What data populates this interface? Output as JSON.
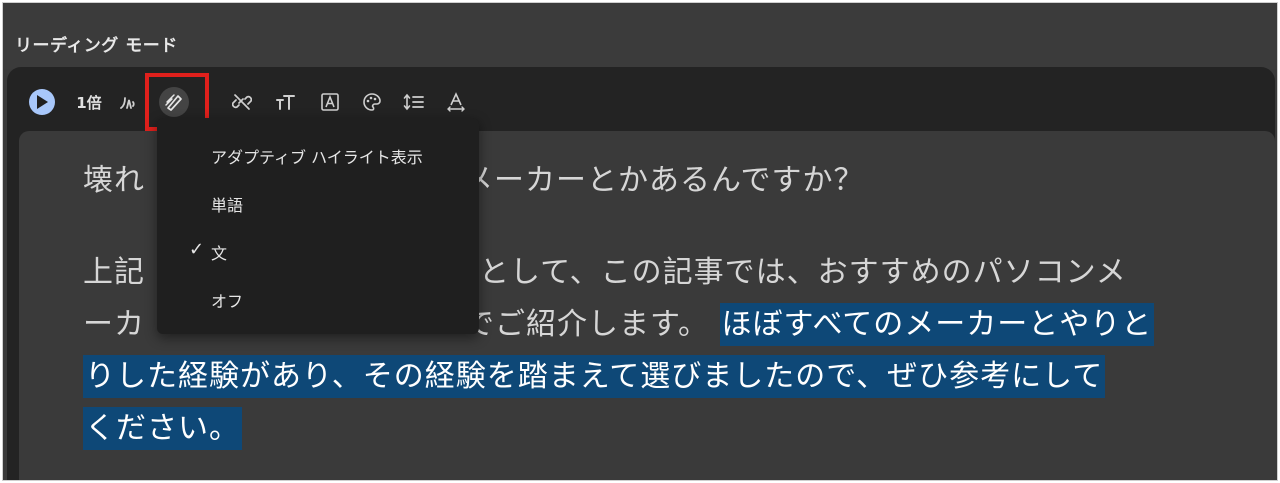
{
  "window": {
    "title": "リーディング モード"
  },
  "toolbar": {
    "play_icon": "play-icon",
    "speed_label": "1倍",
    "voice_icon": "voice-settings-icon",
    "highlight_icon": "highlight-pen-icon",
    "links_icon": "link-off-icon",
    "fontsize_icon": "font-size-icon",
    "font_icon": "font-icon",
    "color_icon": "palette-icon",
    "spacing_icon": "line-spacing-icon",
    "letter_icon": "letter-spacing-icon"
  },
  "content": {
    "heading_left": "壊れ",
    "heading_right": "メーカーとかあるんですか？",
    "paragraph": {
      "line1_left": "上記",
      "line1_right": "えとして、この記事では、おすすめのパソコンメ",
      "line2_left": "ーカ",
      "line2_right": "でご紹介します。",
      "highlighted_1": "ほぼすべてのメーカーとやりと",
      "highlighted_2": "りした経験があり、その経験を踏まえて選びましたので、ぜひ参考にして",
      "highlighted_3": "ください。"
    }
  },
  "highlight_menu": {
    "items": [
      {
        "label": "アダプティブ ハイライト表示",
        "checked": false
      },
      {
        "label": "単語",
        "checked": false
      },
      {
        "label": "文",
        "checked": true,
        "check_mark": "✓"
      },
      {
        "label": "オフ",
        "checked": false
      }
    ]
  },
  "colors": {
    "accent": "#a8c7fa",
    "highlight_bg": "#0e4877",
    "annotation_box": "#e0201c"
  }
}
